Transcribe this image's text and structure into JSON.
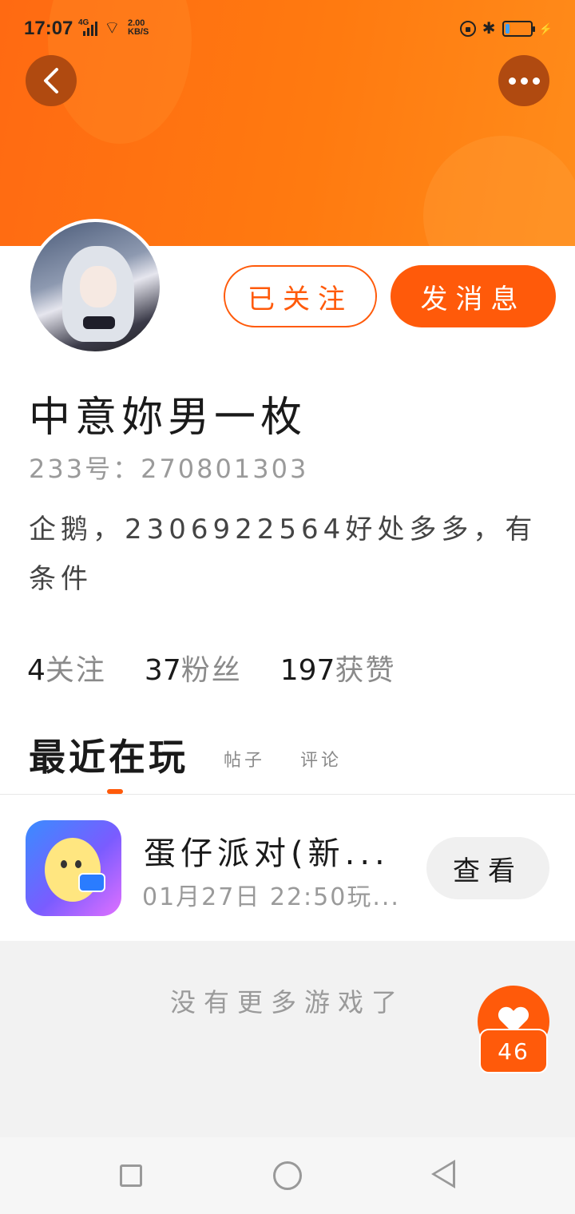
{
  "status_bar": {
    "time": "17:07",
    "network": "4G",
    "speed_value": "2.00",
    "speed_unit": "KB/S",
    "battery_level": 0.15
  },
  "header": {
    "back_icon": "chevron-left-icon",
    "more_icon": "more-dots-icon",
    "accent_color": "#ff6a12"
  },
  "profile": {
    "follow_label": "已关注",
    "message_label": "发消息",
    "name": "中意妳男一枚",
    "uid": "233号：270801303",
    "bio": "企鹅，2306922564好处多多，有条件"
  },
  "stats": {
    "following_count": "4",
    "following_label": "关注",
    "fans_count": "37",
    "fans_label": "粉丝",
    "likes_count": "197",
    "likes_label": "获赞"
  },
  "tabs": {
    "recent": "最近在玩",
    "posts": "帖子",
    "comments": "评论"
  },
  "games": [
    {
      "title": "蛋仔派对(新...",
      "time": "01月27日 22:50玩...",
      "view_label": "查看"
    }
  ],
  "no_more": "没有更多游戏了",
  "like_button": {
    "count": "46",
    "icon": "heart-icon"
  },
  "nav": {
    "recent_icon": "square-icon",
    "home_icon": "circle-icon",
    "back_icon": "triangle-back-icon"
  }
}
